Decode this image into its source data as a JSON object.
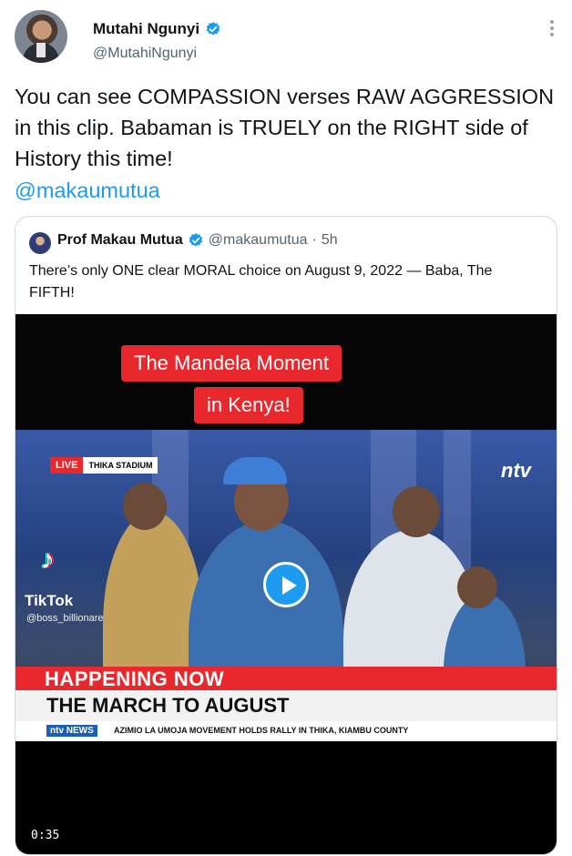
{
  "tweet": {
    "display_name": "Mutahi Ngunyi",
    "handle": "@MutahiNgunyi",
    "text": "You can see COMPASSION verses RAW AGGRESSION in this clip. Babaman is TRUELY on the RIGHT side of History this time!",
    "mention": "@makaumutua"
  },
  "quoted_tweet": {
    "display_name": "Prof Makau Mutua",
    "handle": "@makaumutua",
    "separator": "·",
    "time": "5h",
    "text": "There’s only ONE clear MORAL choice on August 9, 2022 — Baba, The FIFTH!"
  },
  "video": {
    "caption_line1": "The Mandela Moment",
    "caption_line2": "in Kenya!",
    "live_label": "LIVE",
    "location_label": "THIKA STADIUM",
    "channel_logo": "ntv",
    "watermark": "TikTok",
    "watermark_user": "@boss_billionare",
    "banner": "HAPPENING NOW",
    "headline": "THE MARCH TO AUGUST",
    "ticker_tag": "ntv NEWS",
    "ticker_text": "AZIMIO LA UMOJA MOVEMENT HOLDS RALLY IN THIKA, KIAMBU COUNTY",
    "duration": "0:35"
  },
  "colors": {
    "verified": "#1d9bf0",
    "link": "#1d9bf0",
    "accent_red": "#e9282e"
  },
  "icons": [
    "verified-badge-icon",
    "more-options-icon",
    "play-icon",
    "tiktok-icon"
  ]
}
